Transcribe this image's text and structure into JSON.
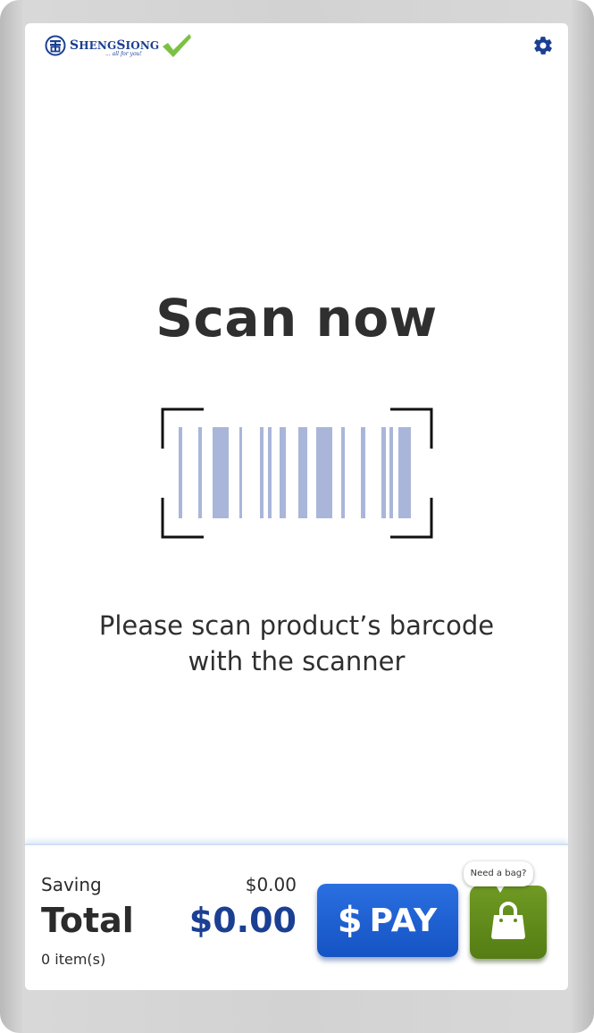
{
  "header": {
    "logo_name_big1": "S",
    "logo_name_small1": "HENG",
    "logo_name_big2": "S",
    "logo_name_small2": "IONG",
    "logo_tagline": "... all for you!",
    "settings_icon": "gear-icon"
  },
  "main": {
    "title": "Scan now",
    "instruction_line1": "Please scan product’s barcode",
    "instruction_line2": "with the scanner",
    "scanner_icon": "barcode-scanner-icon"
  },
  "footer": {
    "saving_label": "Saving",
    "saving_value": "$0.00",
    "total_label": "Total",
    "total_value": "$0.00",
    "items_count": "0 item(s)",
    "pay_symbol": "$",
    "pay_label": "PAY",
    "bag_prompt": "Need a bag?",
    "bag_icon": "shopping-bag-icon"
  },
  "colors": {
    "brand_blue": "#1b3f93",
    "pay_blue": "#1553c4",
    "bag_green": "#5f8a1a",
    "check_green": "#7bc142",
    "barcode": "#aab6d9"
  }
}
